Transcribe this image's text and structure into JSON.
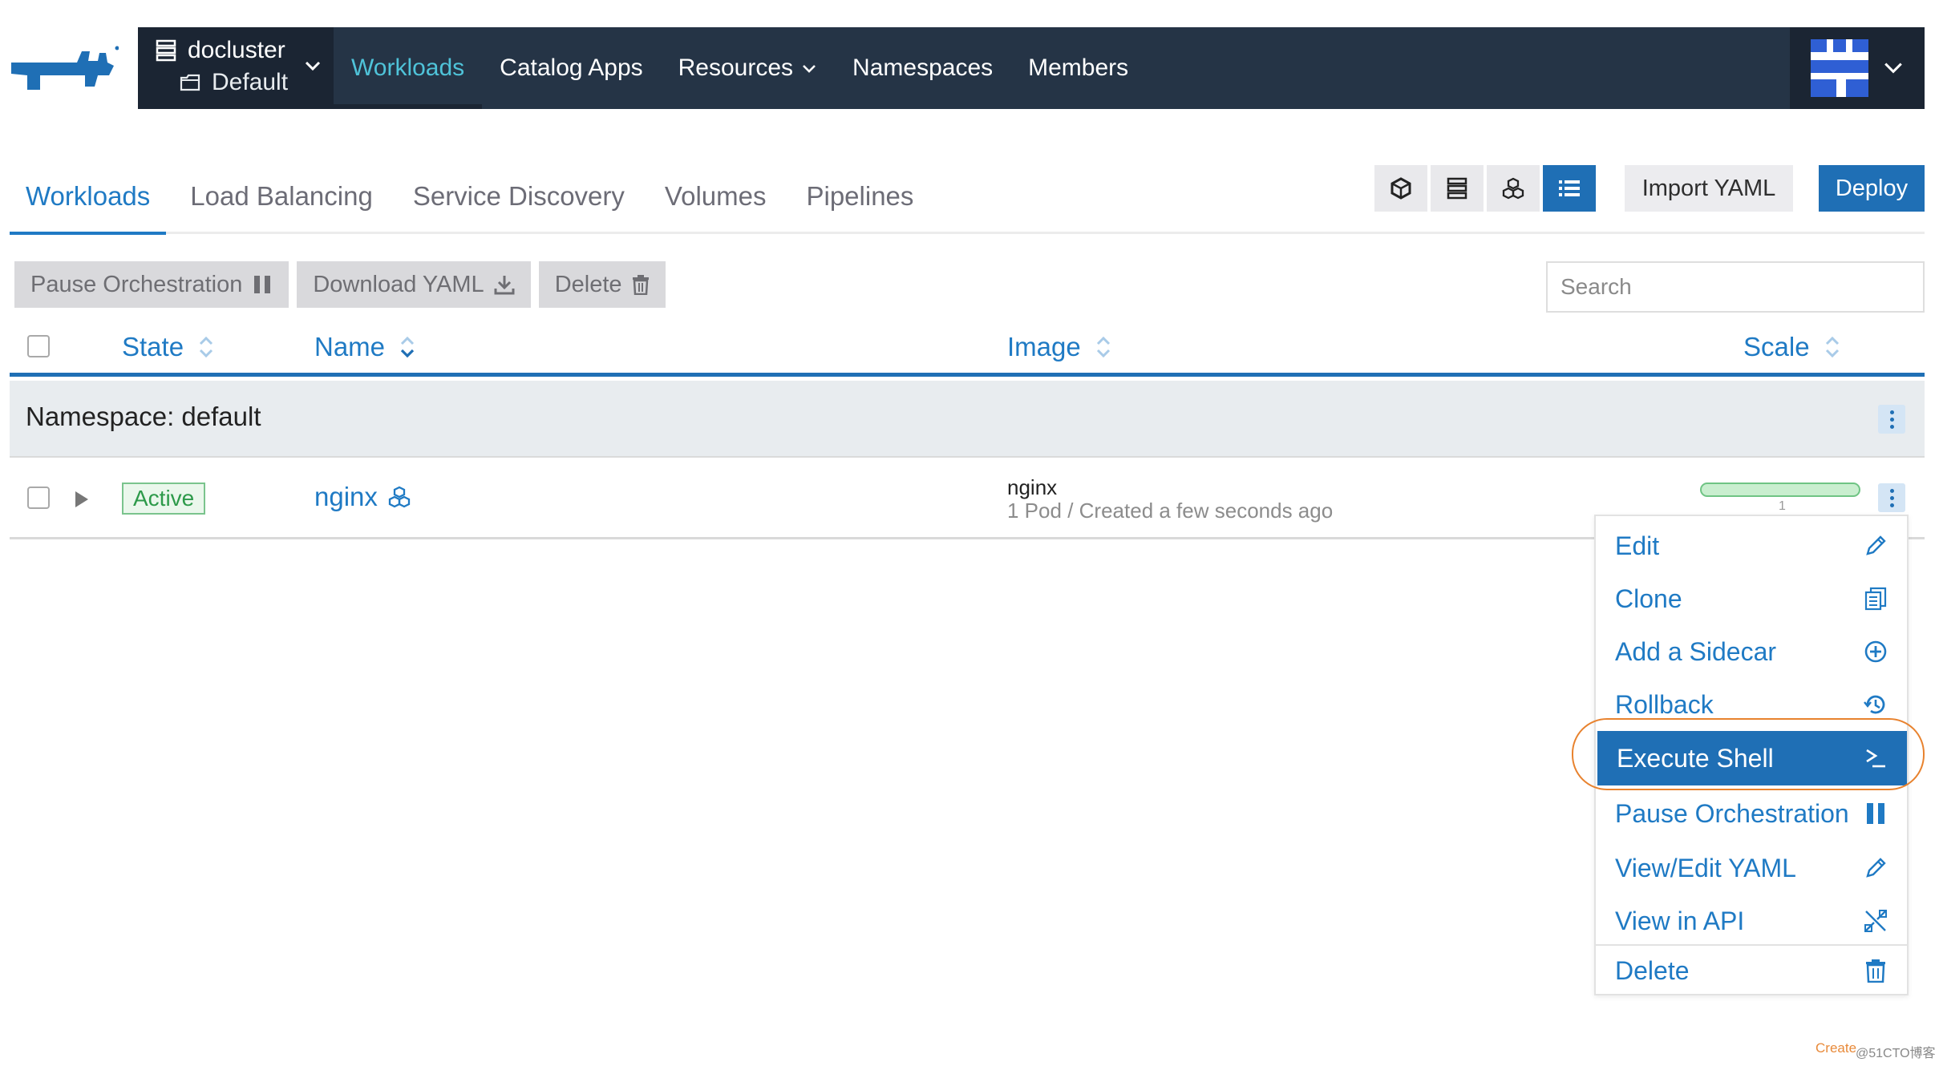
{
  "brand": {
    "logo_icon": "rancher-cow-logo",
    "color": "#1f6fb5"
  },
  "cluster": {
    "name": "docluster",
    "project": "Default"
  },
  "nav": {
    "items": [
      {
        "label": "Workloads",
        "active": true
      },
      {
        "label": "Catalog Apps"
      },
      {
        "label": "Resources",
        "dropdown": true
      },
      {
        "label": "Namespaces"
      },
      {
        "label": "Members"
      }
    ]
  },
  "subtabs": [
    {
      "label": "Workloads",
      "active": true
    },
    {
      "label": "Load Balancing"
    },
    {
      "label": "Service Discovery"
    },
    {
      "label": "Volumes"
    },
    {
      "label": "Pipelines"
    }
  ],
  "toolbar": {
    "import_label": "Import YAML",
    "deploy_label": "Deploy"
  },
  "bulk": {
    "pause_label": "Pause Orchestration",
    "download_label": "Download YAML",
    "delete_label": "Delete"
  },
  "search": {
    "placeholder": "Search"
  },
  "table": {
    "columns": {
      "state": "State",
      "name": "Name",
      "image": "Image",
      "scale": "Scale"
    },
    "namespace_label": "Namespace: default",
    "row": {
      "state": "Active",
      "name": "nginx",
      "image": "nginx",
      "pods": "1 Pod",
      "separator": "/",
      "created": "Created a few seconds ago",
      "scale": "1"
    }
  },
  "menu": {
    "items": [
      {
        "label": "Edit",
        "icon": "pencil-icon"
      },
      {
        "label": "Clone",
        "icon": "clipboard-icon"
      },
      {
        "label": "Add a Sidecar",
        "icon": "plus-circle-icon"
      },
      {
        "label": "Rollback",
        "icon": "history-icon"
      },
      {
        "label": "Execute Shell",
        "icon": "terminal-icon",
        "active": true
      },
      {
        "label": "Pause Orchestration",
        "icon": "pause-icon"
      },
      {
        "label": "View/Edit YAML",
        "icon": "pencil-icon"
      },
      {
        "label": "View in API",
        "icon": "api-icon"
      },
      {
        "label": "Delete",
        "icon": "trash-icon"
      }
    ]
  },
  "watermark": {
    "left": "Create",
    "right": "@51CTO博客"
  }
}
